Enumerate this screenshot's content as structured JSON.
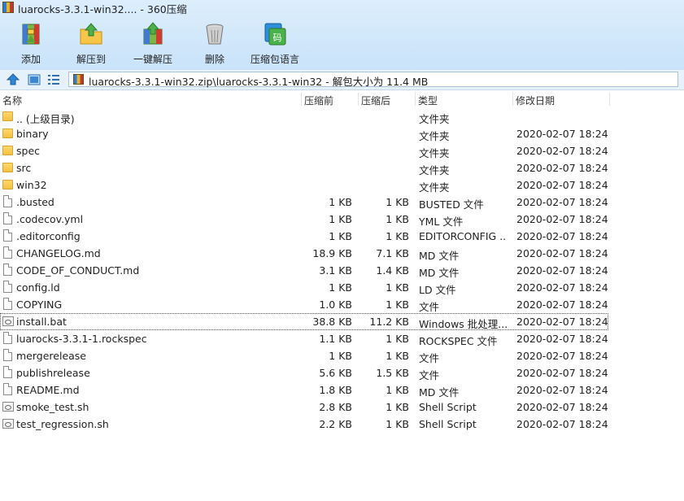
{
  "window": {
    "title": "luarocks-3.3.1-win32.... - 360压缩"
  },
  "toolbar": {
    "add_label": "添加",
    "extract_label": "解压到",
    "onekey_label": "一键解压",
    "delete_label": "删除",
    "lang_label": "压缩包语言"
  },
  "address": {
    "path": "luarocks-3.3.1-win32.zip\\luarocks-3.3.1-win32 - 解包大小为 11.4 MB"
  },
  "columns": {
    "name": "名称",
    "orig": "压缩前",
    "comp": "压缩后",
    "type": "类型",
    "date": "修改日期"
  },
  "files": [
    {
      "name": ".. (上级目录)",
      "orig": "",
      "comp": "",
      "type": "文件夹",
      "date": "",
      "icon": "folder-icon"
    },
    {
      "name": "binary",
      "orig": "",
      "comp": "",
      "type": "文件夹",
      "date": "2020-02-07 18:24",
      "icon": "folder-icon"
    },
    {
      "name": "spec",
      "orig": "",
      "comp": "",
      "type": "文件夹",
      "date": "2020-02-07 18:24",
      "icon": "folder-icon"
    },
    {
      "name": "src",
      "orig": "",
      "comp": "",
      "type": "文件夹",
      "date": "2020-02-07 18:24",
      "icon": "folder-icon"
    },
    {
      "name": "win32",
      "orig": "",
      "comp": "",
      "type": "文件夹",
      "date": "2020-02-07 18:24",
      "icon": "folder-icon"
    },
    {
      "name": ".busted",
      "orig": "1 KB",
      "comp": "1 KB",
      "type": "BUSTED 文件",
      "date": "2020-02-07 18:24",
      "icon": "file-icon"
    },
    {
      "name": ".codecov.yml",
      "orig": "1 KB",
      "comp": "1 KB",
      "type": "YML 文件",
      "date": "2020-02-07 18:24",
      "icon": "file-icon"
    },
    {
      "name": ".editorconfig",
      "orig": "1 KB",
      "comp": "1 KB",
      "type": "EDITORCONFIG ...",
      "date": "2020-02-07 18:24",
      "icon": "file-icon"
    },
    {
      "name": "CHANGELOG.md",
      "orig": "18.9 KB",
      "comp": "7.1 KB",
      "type": "MD 文件",
      "date": "2020-02-07 18:24",
      "icon": "file-icon"
    },
    {
      "name": "CODE_OF_CONDUCT.md",
      "orig": "3.1 KB",
      "comp": "1.4 KB",
      "type": "MD 文件",
      "date": "2020-02-07 18:24",
      "icon": "file-icon"
    },
    {
      "name": "config.ld",
      "orig": "1 KB",
      "comp": "1 KB",
      "type": "LD 文件",
      "date": "2020-02-07 18:24",
      "icon": "file-icon"
    },
    {
      "name": "COPYING",
      "orig": "1.0 KB",
      "comp": "1 KB",
      "type": "文件",
      "date": "2020-02-07 18:24",
      "icon": "file-icon"
    },
    {
      "name": "install.bat",
      "orig": "38.8 KB",
      "comp": "11.2 KB",
      "type": "Windows 批处理...",
      "date": "2020-02-07 18:24",
      "icon": "script-icon",
      "selected": true
    },
    {
      "name": "luarocks-3.3.1-1.rockspec",
      "orig": "1.1 KB",
      "comp": "1 KB",
      "type": "ROCKSPEC 文件",
      "date": "2020-02-07 18:24",
      "icon": "file-icon"
    },
    {
      "name": "mergerelease",
      "orig": "1 KB",
      "comp": "1 KB",
      "type": "文件",
      "date": "2020-02-07 18:24",
      "icon": "file-icon"
    },
    {
      "name": "publishrelease",
      "orig": "5.6 KB",
      "comp": "1.5 KB",
      "type": "文件",
      "date": "2020-02-07 18:24",
      "icon": "file-icon"
    },
    {
      "name": "README.md",
      "orig": "1.8 KB",
      "comp": "1 KB",
      "type": "MD 文件",
      "date": "2020-02-07 18:24",
      "icon": "file-icon"
    },
    {
      "name": "smoke_test.sh",
      "orig": "2.8 KB",
      "comp": "1 KB",
      "type": "Shell Script",
      "date": "2020-02-07 18:24",
      "icon": "script-icon"
    },
    {
      "name": "test_regression.sh",
      "orig": "2.2 KB",
      "comp": "1 KB",
      "type": "Shell Script",
      "date": "2020-02-07 18:24",
      "icon": "script-icon"
    }
  ]
}
